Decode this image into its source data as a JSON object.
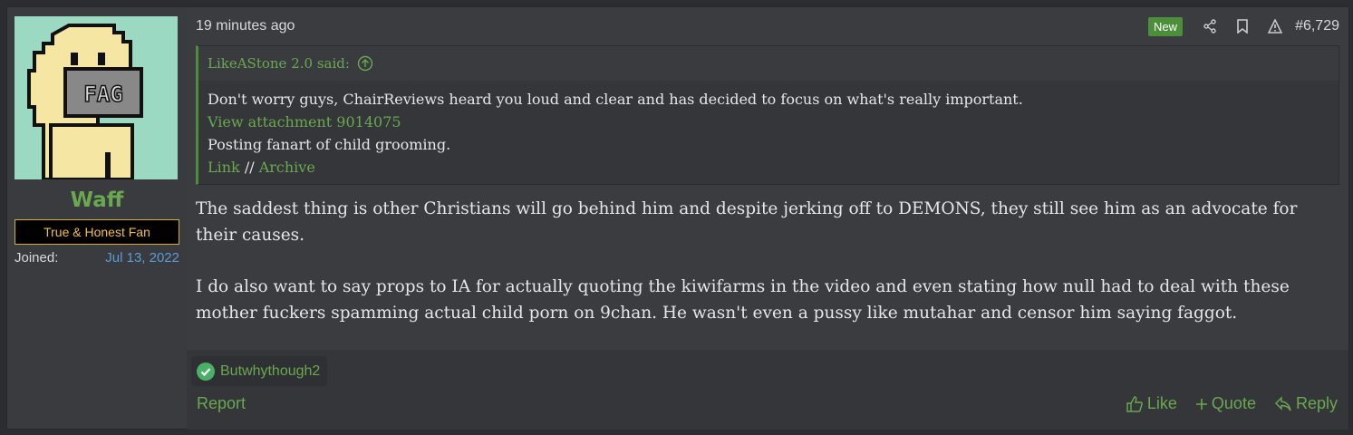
{
  "user": {
    "name": "Waff",
    "title": "True & Honest Fan",
    "joined_label": "Joined:",
    "joined_date": "Jul 13, 2022",
    "avatar_text": "FAG"
  },
  "post": {
    "time": "19 minutes ago",
    "new_badge": "New",
    "number": "#6,729",
    "quote": {
      "author_line": "LikeAStone 2.0 said:",
      "line1": "Don't worry guys, ChairReviews heard you loud and clear and has decided to focus on what's really important.",
      "attachment": "View attachment 9014075",
      "line2": "Posting fanart of child grooming.",
      "link": "Link",
      "separator": " // ",
      "archive": "Archive"
    },
    "paragraphs": [
      "The saddest thing is other Christians will go behind him and despite jerking off to DEMONS, they still see him as an advocate for their causes.",
      "I do also want to say props to IA for actually quoting the kiwifarms in the video and even stating how null had to deal with these mother fuckers spamming actual child porn on 9chan. He wasn't even a pussy like mutahar and censor him saying faggot."
    ]
  },
  "reactions": {
    "user": "Butwhythough2"
  },
  "actions": {
    "report": "Report",
    "like": "Like",
    "quote": "Quote",
    "reply": "Reply"
  },
  "colors": {
    "accent": "#6aa84f",
    "link_blue": "#5b9bd5",
    "title_gold": "#f1c232",
    "background": "#3a3c40"
  }
}
